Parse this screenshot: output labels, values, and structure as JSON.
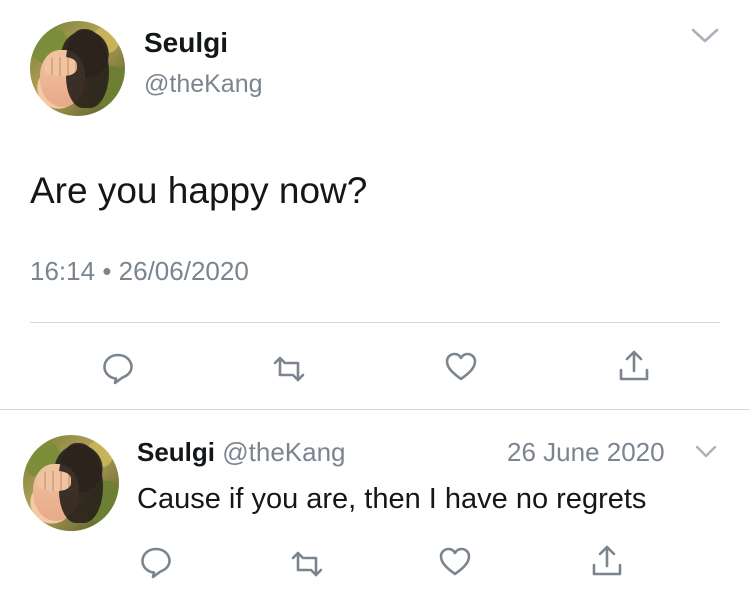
{
  "main_tweet": {
    "name": "Seulgi",
    "handle": "@theKang",
    "text": "Are you happy now?",
    "time": "16:14",
    "separator": "•",
    "date": "26/06/2020",
    "actions": [
      "reply-icon",
      "retweet-icon",
      "like-icon",
      "share-icon"
    ]
  },
  "reply_tweet": {
    "name": "Seulgi",
    "handle": "@theKang",
    "date": "26 June 2020",
    "text": "Cause if you are, then I have no regrets",
    "actions": [
      "reply-icon",
      "retweet-icon",
      "like-icon",
      "share-icon"
    ]
  },
  "colors": {
    "text": "#14171a",
    "muted": "#7b858f",
    "divider": "#d4d9dd"
  }
}
